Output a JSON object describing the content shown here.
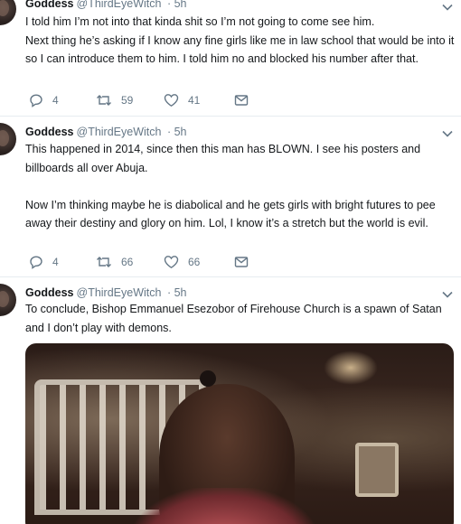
{
  "tweets": [
    {
      "name": "Goddess",
      "handle": "@ThirdEyeWitch",
      "time": "· 5h",
      "text": "I told him I’m not into that kinda shit so I’m not going to come see him.\nNext thing he’s asking if I know any fine girls like me in law school that would be into it so I can introduce them to him. I told him no and blocked his number after that.",
      "replies": "4",
      "retweets": "59",
      "likes": "41"
    },
    {
      "name": "Goddess",
      "handle": "@ThirdEyeWitch",
      "time": "· 5h",
      "text": "This happened in 2014, since then this man has BLOWN. I see his posters and billboards all over Abuja.\n\nNow I’m thinking maybe he is diabolical and he gets girls with bright futures to pee away their destiny and glory on him. Lol, I know it’s a stretch but the world is evil.",
      "replies": "4",
      "retweets": "66",
      "likes": "66"
    },
    {
      "name": "Goddess",
      "handle": "@ThirdEyeWitch",
      "time": "· 5h",
      "text": "To conclude, Bishop Emmanuel Esezobor of Firehouse Church is a spawn of Satan and I don’t play with demons."
    }
  ],
  "colors": {
    "text": "#14171a",
    "muted": "#657786",
    "divider": "#e6ecf0"
  },
  "icons": [
    "reply-icon",
    "retweet-icon",
    "like-icon",
    "message-icon",
    "chevron-down-icon"
  ]
}
